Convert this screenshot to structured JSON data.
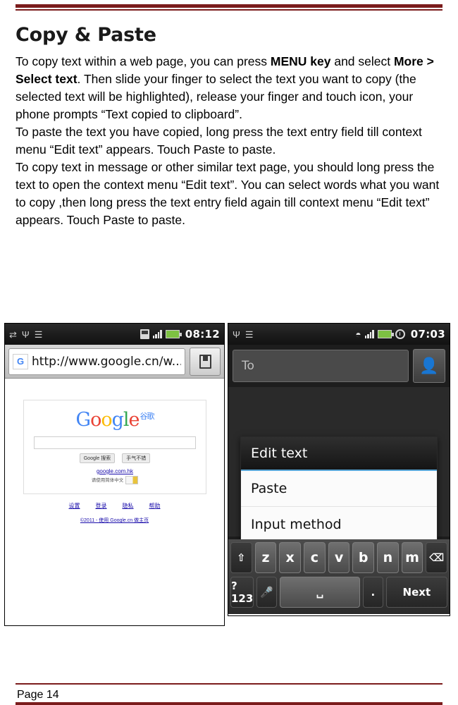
{
  "document": {
    "title": "Copy & Paste",
    "paragraphs": [
      {
        "id": "p1",
        "segments": [
          {
            "text": "To copy text within a web page, you can press ",
            "bold": false
          },
          {
            "text": "MENU key",
            "bold": true
          },
          {
            "text": " and select ",
            "bold": false
          },
          {
            "text": "More > Select text",
            "bold": true
          },
          {
            "text": ". Then slide your finger to select the text you want to copy (the selected text will be highlighted), release your finger and touch  icon, your phone prompts “Text copied to clipboard”.",
            "bold": false
          }
        ]
      },
      {
        "id": "p2",
        "segments": [
          {
            "text": "To paste the text you have copied, long press the text entry field till context menu “Edit text” appears. Touch Paste to paste.",
            "bold": false
          }
        ]
      },
      {
        "id": "p3",
        "segments": [
          {
            "text": "To copy text in message or other similar text page, you should long press the text to open the context menu “Edit text”. You can select words what you  want to copy ,then long press the text entry field again till context menu “Edit text” appears. Touch Paste to paste.",
            "bold": false
          }
        ]
      }
    ],
    "footer": "Page 14"
  },
  "screenshot_browser": {
    "statusbar": {
      "time": "08:12",
      "icons_left": [
        "sync-icon",
        "usb-icon",
        "vibrate-icon"
      ],
      "icons_right": [
        "sd-card-icon",
        "signal-icon",
        "message-icon"
      ]
    },
    "urlbar": {
      "favicon_letter": "G",
      "url": "http://www.google.cn/w...",
      "bookmark_icon": "bookmark-icon"
    },
    "webpage": {
      "logo_letters": [
        "G",
        "o",
        "o",
        "g",
        "l",
        "e"
      ],
      "logo_suffix": "谷歌",
      "buttons": [
        "Google 搜索",
        "手气不错"
      ],
      "hk_link": "google.com.hk",
      "hk_sub": "请使用简体中文",
      "footer_links": [
        "设置",
        "登录",
        "隐私",
        "帮助"
      ],
      "copyright": "©2011 - 使用 Google.cn 做主页"
    }
  },
  "screenshot_message": {
    "statusbar": {
      "time": "07:03",
      "icons_left": [
        "usb-icon",
        "vibrate-icon"
      ],
      "icons_right": [
        "wifi-icon",
        "signal-icon",
        "message-icon",
        "alarm-icon"
      ]
    },
    "compose": {
      "to_placeholder": "To",
      "contact_picker_icon": "contact-icon"
    },
    "context_menu": {
      "title": "Edit text",
      "items": [
        "Paste",
        "Input method"
      ]
    },
    "keyboard": {
      "row1": [
        "⇧",
        "z",
        "x",
        "c",
        "v",
        "b",
        "n",
        "m",
        "⌫"
      ],
      "row2": [
        "?123",
        "🎤",
        "␣",
        ".",
        "Next"
      ]
    }
  },
  "colors": {
    "rule": "#7b1c1c",
    "accent_blue": "#4285f4",
    "battery_green": "#7dc142"
  }
}
